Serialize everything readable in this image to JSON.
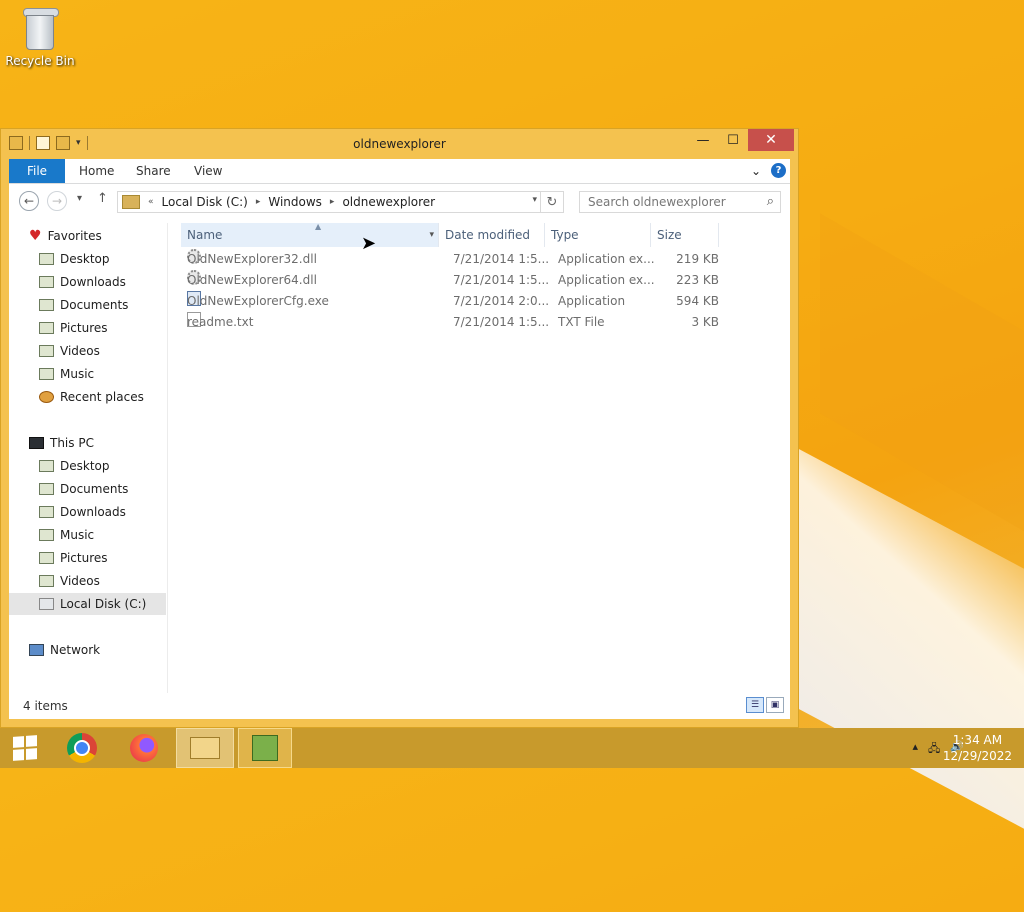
{
  "desktop": {
    "recycle_bin_label": "Recycle Bin"
  },
  "window": {
    "title": "oldnewexplorer",
    "minimize": "—",
    "maximize": "☐",
    "close": "✕"
  },
  "ribbon": {
    "tabs": [
      "File",
      "Home",
      "Share",
      "View"
    ],
    "expand": "⌄",
    "help": "?"
  },
  "nav": {
    "back": "←",
    "forward": "→",
    "recent": "▾",
    "up": "↑"
  },
  "address": {
    "overflow": "«",
    "crumbs": [
      "Local Disk (C:)",
      "Windows",
      "oldnewexplorer"
    ],
    "sep": "▸",
    "dropdown": "▾",
    "refresh": "↻"
  },
  "search": {
    "placeholder": "Search oldnewexplorer",
    "icon": "⌕"
  },
  "nav_pane": {
    "favorites_label": "Favorites",
    "favorites": [
      "Desktop",
      "Downloads",
      "Documents",
      "Pictures",
      "Videos",
      "Music",
      "Recent places"
    ],
    "thispc_label": "This PC",
    "thispc": [
      "Desktop",
      "Documents",
      "Downloads",
      "Music",
      "Pictures",
      "Videos",
      "Local Disk (C:)"
    ],
    "network_label": "Network"
  },
  "columns": {
    "name": "Name",
    "date": "Date modified",
    "type": "Type",
    "size": "Size",
    "sort_indicator": "▲",
    "filter": "▾"
  },
  "files": [
    {
      "name": "OldNewExplorer32.dll",
      "date": "7/21/2014 1:5...",
      "type": "Application ex...",
      "size": "219 KB",
      "icon": "gear-icon"
    },
    {
      "name": "OldNewExplorer64.dll",
      "date": "7/21/2014 1:5...",
      "type": "Application ex...",
      "size": "223 KB",
      "icon": "gear-icon"
    },
    {
      "name": "OldNewExplorerCfg.exe",
      "date": "7/21/2014 2:0...",
      "type": "Application",
      "size": "594 KB",
      "icon": "application-icon"
    },
    {
      "name": "readme.txt",
      "date": "7/21/2014 1:5...",
      "type": "TXT File",
      "size": "3 KB",
      "icon": "text-file-icon"
    }
  ],
  "status": {
    "item_count": "4 items",
    "details_view": "☰",
    "large_icons_view": "▣"
  },
  "taskbar": {
    "time": "1:34 AM",
    "date": "12/29/2022",
    "tray_arrow": "▴",
    "network": "🖧",
    "volume": "🔊"
  },
  "colors": {
    "desktop_bg": "#f6ac12",
    "window_frame": "#f4c24f",
    "close_button": "#c7504b",
    "file_tab": "#1979ca",
    "taskbar": "#c89a2c"
  }
}
